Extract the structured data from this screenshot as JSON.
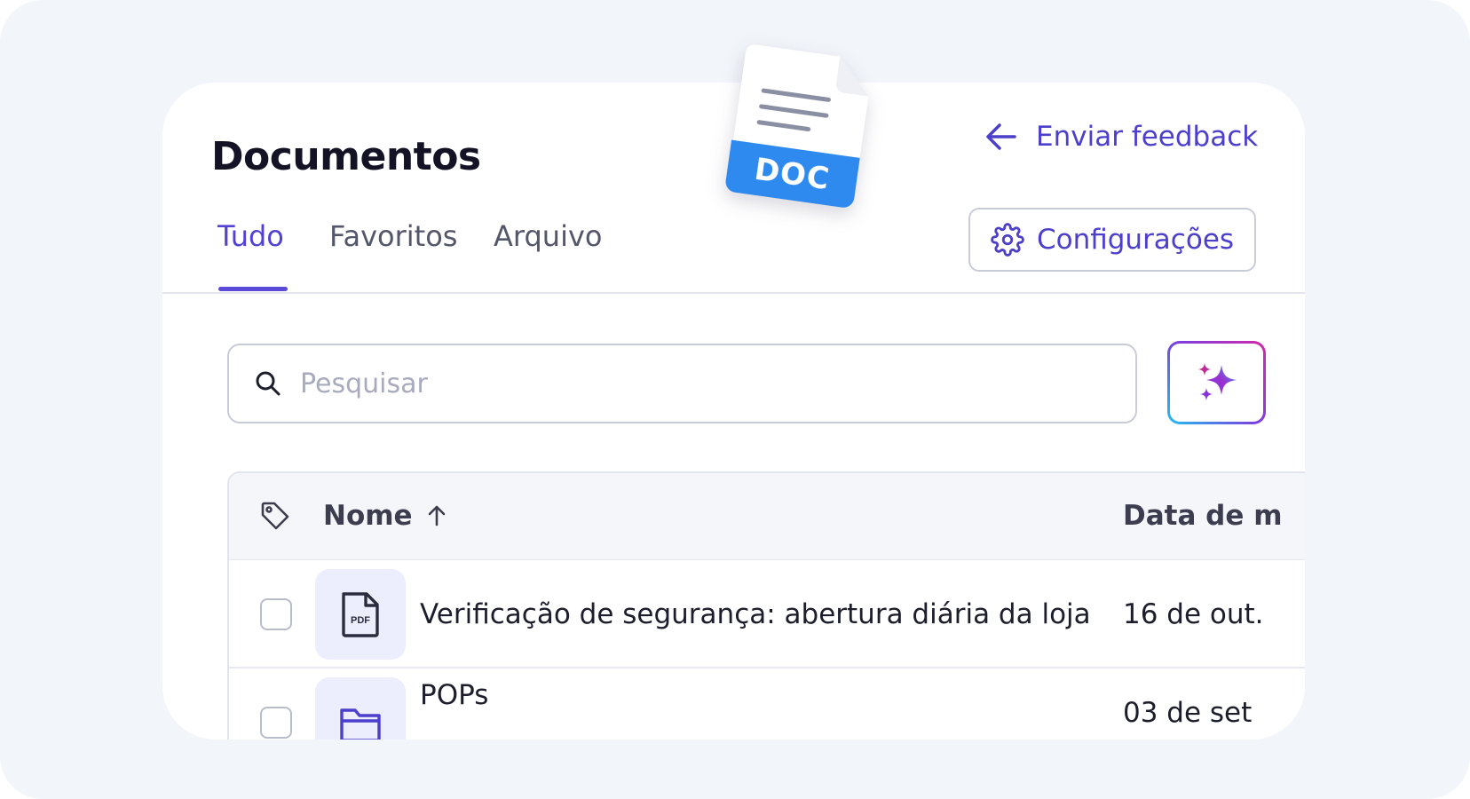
{
  "page": {
    "title": "Documentos",
    "feedback_label": "Enviar feedback",
    "settings_label": "Configurações"
  },
  "tabs": [
    {
      "label": "Tudo",
      "active": true
    },
    {
      "label": "Favoritos",
      "active": false
    },
    {
      "label": "Arquivo",
      "active": false
    }
  ],
  "search": {
    "placeholder": "Pesquisar",
    "value": ""
  },
  "ai_button": {
    "icon": "sparkles-icon"
  },
  "doc_badge": {
    "label": "DOC"
  },
  "table": {
    "columns": [
      {
        "label": "Tag",
        "icon": "tag-icon"
      },
      {
        "label": "Nome",
        "sort": "ascending"
      },
      {
        "label": "Data de m"
      }
    ],
    "rows": [
      {
        "icon": "pdf-file-icon",
        "name": "Verificação de segurança: abertura diária da loja",
        "date": "16 de out."
      },
      {
        "icon": "folder-icon",
        "name": "POPs",
        "date": "03 de set"
      }
    ]
  },
  "colors": {
    "accent": "#4b3fcc",
    "tab_active": "#5242d4",
    "icon_bg": "#eceefe",
    "page_bg": "#f2f5fa",
    "doc_band": "#2f8af0"
  }
}
